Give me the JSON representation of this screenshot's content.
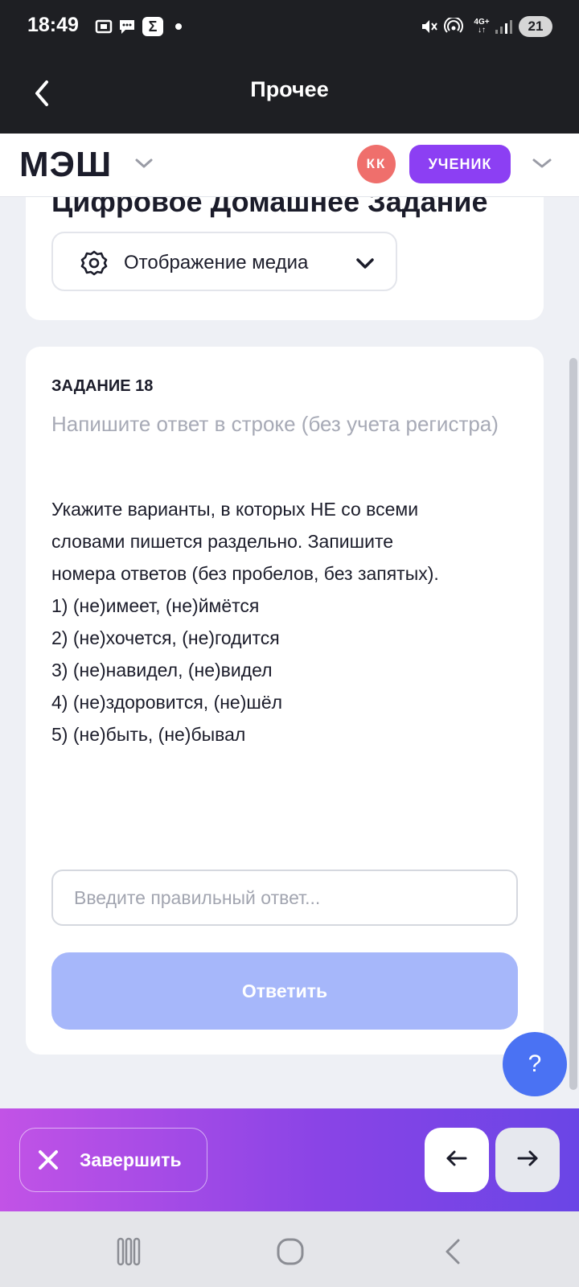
{
  "status_bar": {
    "time": "18:49",
    "left_icons": [
      "screenshot-icon",
      "chat-icon",
      "sigma-icon",
      "dot-icon"
    ],
    "right_icons": [
      "mute-icon",
      "hotspot-icon",
      "network-4g-icon",
      "signal-icon"
    ],
    "network_label": "4G+",
    "battery": "21"
  },
  "nav": {
    "title": "Прочее",
    "back_icon": "back-chevron-icon"
  },
  "header": {
    "logo": "МЭШ",
    "avatar_initials": "КК",
    "role": "УЧЕНИК",
    "colors": {
      "avatar": "#ef6f6c",
      "role": "#8c3ff3"
    }
  },
  "header_card": {
    "title": "Цифровое Домашнее Задание",
    "media_button_label": "Отображение медиа"
  },
  "task": {
    "number_label": "ЗАДАНИЕ 18",
    "hint": "Напишите ответ в строке (без учета регистра)",
    "question_lines": [
      "Укажите варианты, в которых НЕ со всеми",
      "словами пишется раздельно. Запишите",
      "номера ответов  (без пробелов, без запятых).",
      "1) (не)имеет, (не)ймётся",
      "2) (не)хочется, (не)годится",
      "3) (не)навидел, (не)видел",
      "4) (не)здоровится, (не)шёл",
      "5) (не)быть, (не)бывал"
    ],
    "input_value": "",
    "input_placeholder": "Введите правильный ответ...",
    "submit_label": "Ответить"
  },
  "help_label": "?",
  "action_bar": {
    "finish_label": "Завершить",
    "prev_icon": "arrow-left-icon",
    "next_icon": "arrow-right-icon",
    "colors": {
      "gradient_start": "#c253e6",
      "gradient_end": "#6a45e6"
    }
  },
  "system_nav": [
    "recent-apps-icon",
    "home-icon",
    "back-icon"
  ]
}
